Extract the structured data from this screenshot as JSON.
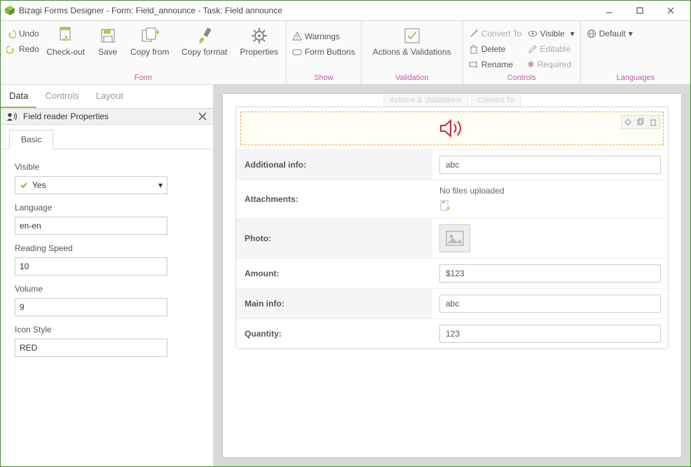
{
  "window": {
    "title": "Bizagi Forms Designer  -  Form: Field_announce - Task:  Field announce"
  },
  "ribbon": {
    "undo": "Undo",
    "redo": "Redo",
    "checkout": "Check-out",
    "save": "Save",
    "copyfrom": "Copy from",
    "copyformat": "Copy format",
    "properties": "Properties",
    "group_form": "Form",
    "warnings": "Warnings",
    "formbuttons": "Form Buttons",
    "group_show": "Show",
    "actions": "Actions & Validations",
    "group_validation": "Validation",
    "convertto": "Convert To",
    "delete": "Delete",
    "rename": "Rename",
    "visible": "Visible",
    "editable": "Editable",
    "required": "Required",
    "group_controls": "Controls",
    "default": "Default",
    "group_languages": "Languages"
  },
  "left": {
    "tabs": {
      "data": "Data",
      "controls": "Controls",
      "layout": "Layout"
    },
    "prop_title": "Field reader Properties",
    "basic_tab": "Basic",
    "fields": {
      "visible_label": "Visible",
      "visible_value": "Yes",
      "language_label": "Language",
      "language_value": "en-en",
      "speed_label": "Reading Speed",
      "speed_value": "10",
      "volume_label": "Volume",
      "volume_value": "9",
      "iconstyle_label": "Icon Style",
      "iconstyle_value": "RED"
    }
  },
  "ghost": {
    "actions": "Actions & Validations",
    "convert": "Convert To"
  },
  "form": {
    "rows": {
      "addinfo_label": "Additional info:",
      "addinfo_value": "abc",
      "attachments_label": "Attachments:",
      "attachments_text": "No files uploaded",
      "photo_label": "Photo:",
      "amount_label": "Amount:",
      "amount_value": "$123",
      "maininfo_label": "Main info:",
      "maininfo_value": "abc",
      "quantity_label": "Quantity:",
      "quantity_value": "123"
    }
  }
}
